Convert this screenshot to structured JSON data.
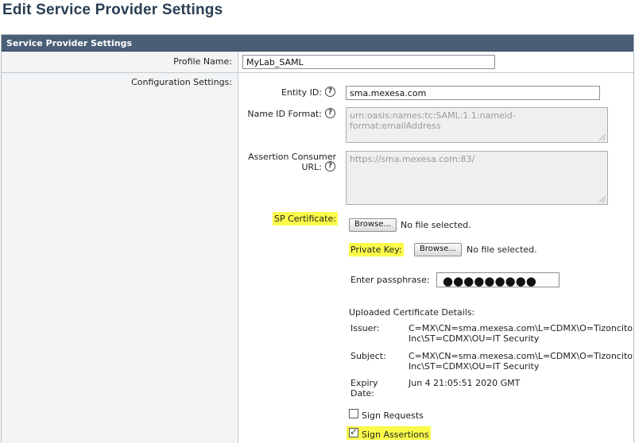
{
  "page": {
    "title": "Edit Service Provider Settings"
  },
  "panel": {
    "header": "Service Provider Settings"
  },
  "profile": {
    "label": "Profile Name:",
    "value": "MyLab_SAML"
  },
  "config": {
    "label": "Configuration Settings:",
    "entity_id": {
      "label": "Entity ID:",
      "value": "sma.mexesa.com",
      "help": "?"
    },
    "name_id_format": {
      "label": "Name ID Format:",
      "value": "urn:oasis:names:tc:SAML:1.1:nameid-format:emailAddress",
      "help": "?"
    },
    "acs_url": {
      "label_line1": "Assertion Consumer",
      "label_line2": "URL:",
      "value": "https://sma.mexesa.com:83/",
      "help": "?"
    },
    "sp_certificate": {
      "label": "SP Certificate:",
      "browse": "Browse...",
      "file_status": "No file selected."
    },
    "private_key": {
      "label": "Private Key:",
      "browse": "Browse...",
      "file_status": "No file selected."
    },
    "passphrase": {
      "label": "Enter passphrase:",
      "value": "●●●●●●●●●"
    },
    "uploaded": {
      "heading": "Uploaded Certificate Details:",
      "issuer_label": "Issuer:",
      "issuer_line1": "C=MX\\CN=sma.mexesa.com\\L=CDMX\\O=Tizoncito",
      "issuer_line2": "Inc\\ST=CDMX\\OU=IT Security",
      "subject_label": "Subject:",
      "subject_line1": "C=MX\\CN=sma.mexesa.com\\L=CDMX\\O=Tizoncito",
      "subject_line2": "Inc\\ST=CDMX\\OU=IT Security",
      "expiry_label_line1": "Expiry",
      "expiry_label_line2": "Date:",
      "expiry_value": "Jun 4 21:05:51 2020 GMT"
    },
    "sign_requests": {
      "label": "Sign Requests",
      "checked": false
    },
    "sign_assertions": {
      "label": "Sign Assertions",
      "checked": true
    }
  },
  "colors": {
    "header_bg": "#4a5f77",
    "title": "#2b3e55",
    "highlight": "#fbfb4a"
  }
}
